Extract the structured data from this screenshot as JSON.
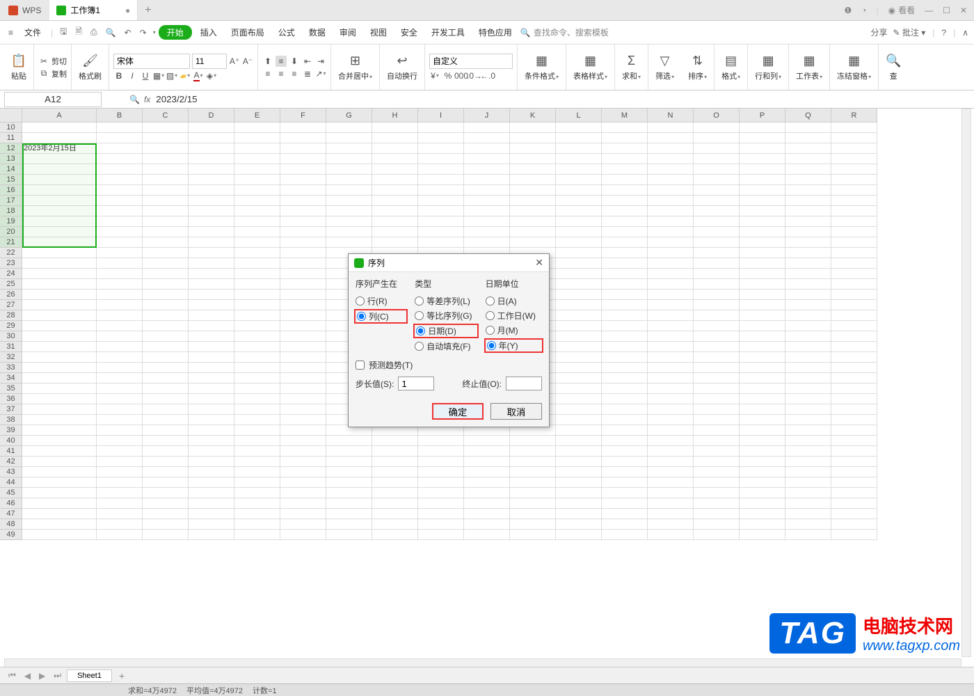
{
  "titlebar": {
    "app": "WPS",
    "tab": "工作簿1",
    "user": "看看"
  },
  "menubar": {
    "file": "文件",
    "items": [
      "开始",
      "插入",
      "页面布局",
      "公式",
      "数据",
      "审阅",
      "视图",
      "安全",
      "开发工具",
      "特色应用"
    ],
    "search_placeholder": "查找命令、搜索模板",
    "share": "分享",
    "annotate": "批注"
  },
  "toolbar": {
    "paste": "粘贴",
    "cut": "剪切",
    "copy": "复制",
    "format_painter": "格式刷",
    "font": "宋体",
    "size": "11",
    "merge": "合并居中",
    "wrap": "自动换行",
    "numfmt": "自定义",
    "condfmt": "条件格式",
    "tablestyle": "表格样式",
    "sum": "求和",
    "filter": "筛选",
    "sort": "排序",
    "format": "格式",
    "rowcol": "行和列",
    "sheet": "工作表",
    "freeze": "冻结窗格",
    "find": "查"
  },
  "formula": {
    "cell_ref": "A12",
    "value": "2023/2/15"
  },
  "columns": [
    "A",
    "B",
    "C",
    "D",
    "E",
    "F",
    "G",
    "H",
    "I",
    "J",
    "K",
    "L",
    "M",
    "N",
    "O",
    "P",
    "Q",
    "R"
  ],
  "rows": [
    10,
    11,
    12,
    13,
    14,
    15,
    16,
    17,
    18,
    19,
    20,
    21,
    22,
    23,
    24,
    25,
    26,
    27,
    28,
    29,
    30,
    31,
    32,
    33,
    34,
    35,
    36,
    37,
    38,
    39,
    40,
    41,
    42,
    43,
    44,
    45,
    46,
    47,
    48,
    49
  ],
  "cells": {
    "A12": "2023年2月15日"
  },
  "dialog": {
    "title": "序列",
    "grp_in": "序列产生在",
    "row_r": "行(R)",
    "col_c": "列(C)",
    "grp_type": "类型",
    "arith": "等差序列(L)",
    "geom": "等比序列(G)",
    "date": "日期(D)",
    "autofill": "自动填充(F)",
    "grp_unit": "日期单位",
    "day": "日(A)",
    "workday": "工作日(W)",
    "month": "月(M)",
    "year": "年(Y)",
    "trend": "预测趋势(T)",
    "step": "步长值(S):",
    "step_val": "1",
    "end": "终止值(O):",
    "end_val": "",
    "ok": "确定",
    "cancel": "取消"
  },
  "sheet": {
    "name": "Sheet1"
  },
  "status": {
    "sum": "求和=4万4972",
    "avg": "平均值=4万4972",
    "count": "计数=1"
  },
  "watermark": {
    "tag": "TAG",
    "line1": "电脑技术网",
    "line2": "www.tagxp.com"
  }
}
